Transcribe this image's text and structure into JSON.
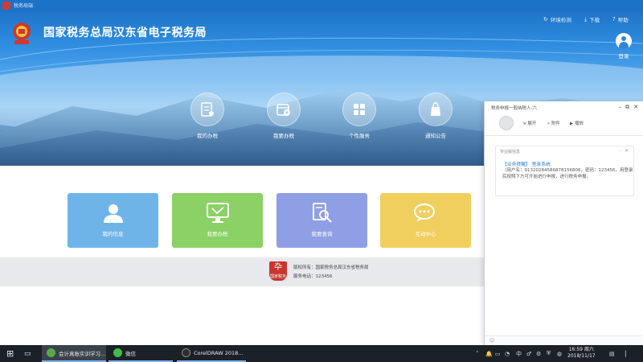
{
  "window": {
    "title": "税务局端"
  },
  "header": {
    "site_title": "国家税务总局汉东省电子税务局",
    "links": [
      {
        "label": "环境检测",
        "icon": "refresh-icon"
      },
      {
        "label": "下载",
        "icon": "download-icon"
      },
      {
        "label": "帮助",
        "icon": "help-icon"
      }
    ],
    "login_label": "登录"
  },
  "nav": [
    {
      "label": "我的办税",
      "icon": "document-icon"
    },
    {
      "label": "我要办税",
      "icon": "calendar-icon"
    },
    {
      "label": "个性服务",
      "icon": "grid-icon"
    },
    {
      "label": "通知公告",
      "icon": "bag-icon"
    }
  ],
  "cards": [
    {
      "label": "我的信息",
      "color": "#6fb4e9",
      "icon": "person-icon"
    },
    {
      "label": "我要办税",
      "color": "#8bd166",
      "icon": "monitor-icon"
    },
    {
      "label": "我要查询",
      "color": "#8f9fe6",
      "icon": "search-document-icon"
    },
    {
      "label": "互动中心",
      "color": "#f1cf5e",
      "icon": "chat-icon"
    }
  ],
  "footer": {
    "logo_text": "国家税务",
    "line1": "版权所有：国家税务总局汉东省税务局",
    "line2": "服务电话：123456"
  },
  "popup": {
    "title": "税务申报一般纳税人-六",
    "actions": [
      "展开",
      "附件",
      "播放"
    ],
    "msg_header": "专业版信息",
    "msg_title": "【业务提醒】 登录系统",
    "msg_body": "（用户名：91320284586878156806，密码：123456，用登录后按照下方可开始进行申报，进行税务申报。"
  },
  "taskbar": {
    "apps": [
      {
        "label": "会计真账实训学习...",
        "state": "active",
        "color": "#5aa84a"
      },
      {
        "label": "微信",
        "state": "open",
        "color": "#3fbf4a"
      },
      {
        "label": "CorelDRAW 2018...",
        "state": "open",
        "color": "#2d2d2d"
      }
    ],
    "ime": "中",
    "time": "16:59 周六",
    "date": "2018/11/17"
  }
}
